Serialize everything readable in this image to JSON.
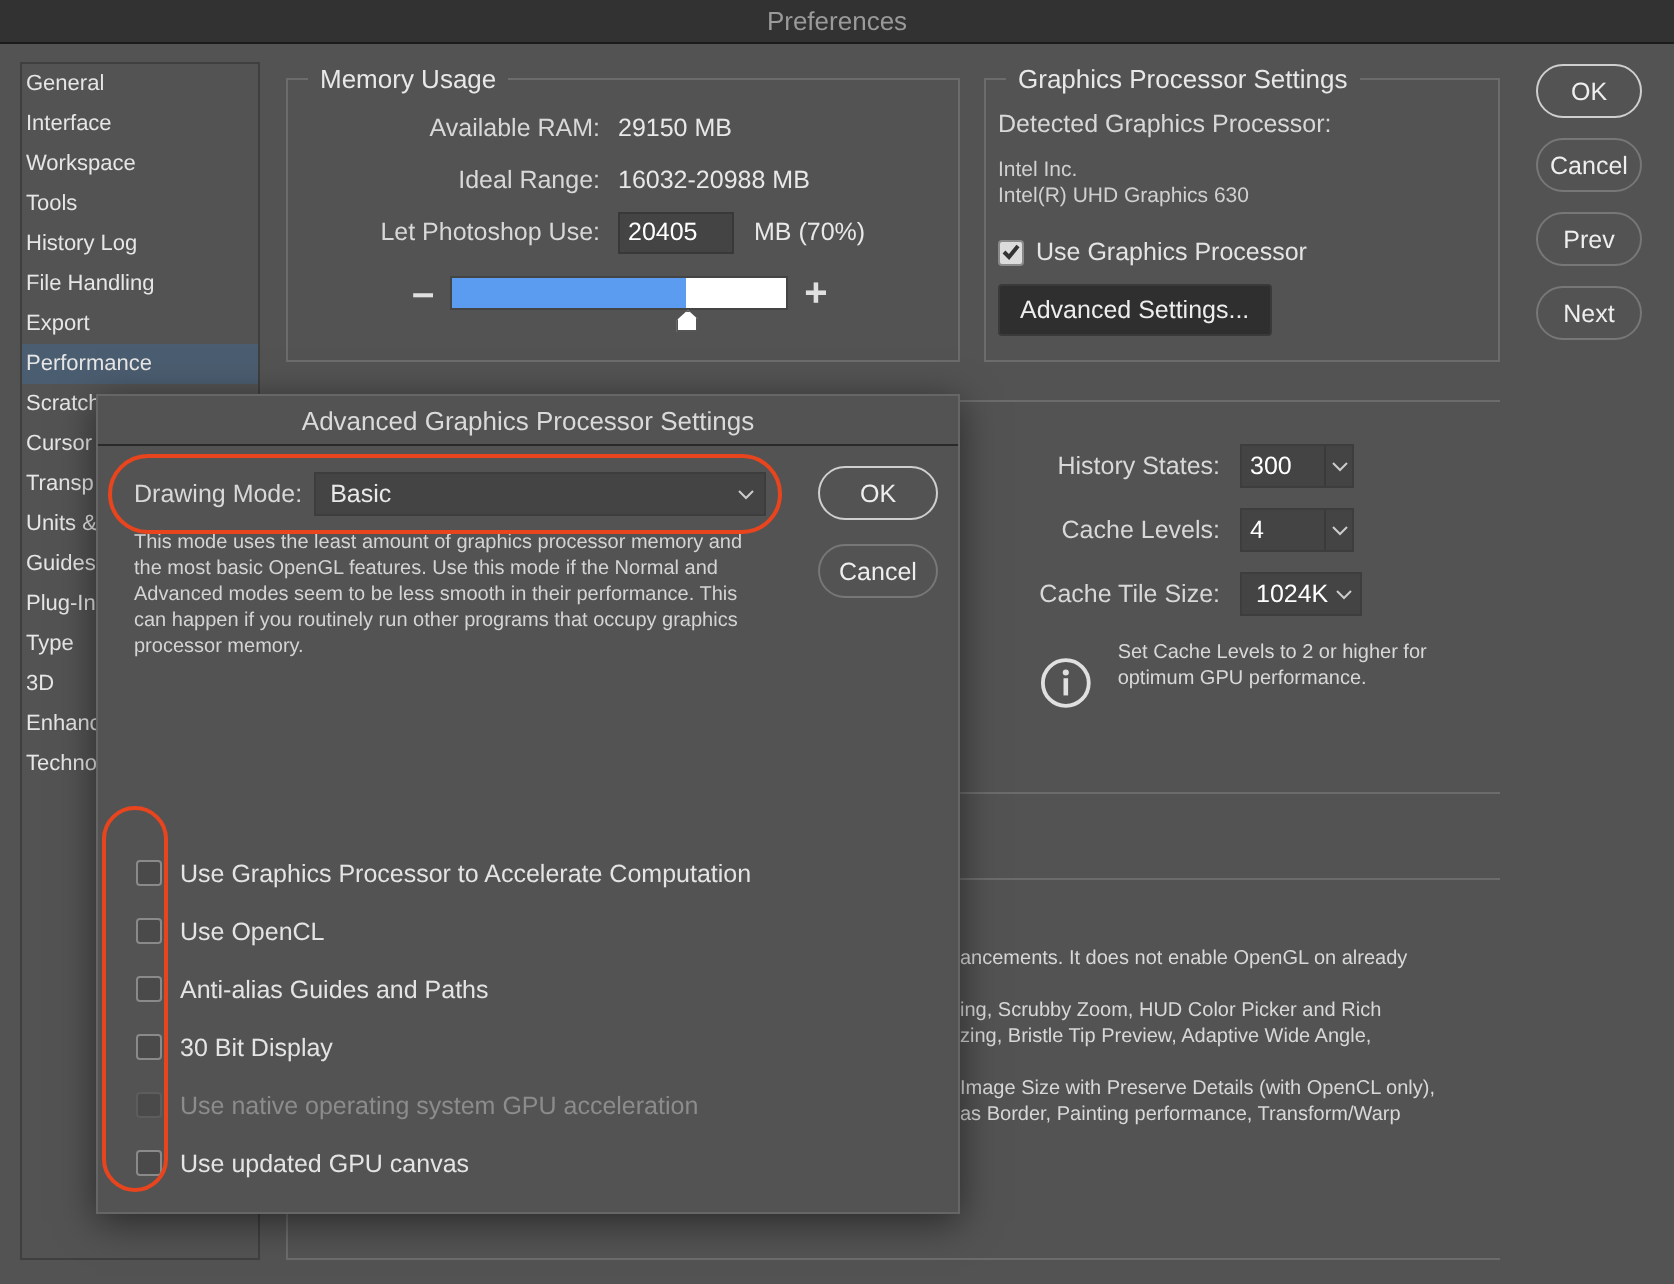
{
  "window": {
    "title": "Preferences"
  },
  "sidebar": {
    "items": [
      {
        "label": "General",
        "selected": false
      },
      {
        "label": "Interface",
        "selected": false
      },
      {
        "label": "Workspace",
        "selected": false
      },
      {
        "label": "Tools",
        "selected": false
      },
      {
        "label": "History Log",
        "selected": false
      },
      {
        "label": "File Handling",
        "selected": false
      },
      {
        "label": "Export",
        "selected": false
      },
      {
        "label": "Performance",
        "selected": true
      },
      {
        "label": "Scratch",
        "selected": false
      },
      {
        "label": "Cursor",
        "selected": false
      },
      {
        "label": "Transp",
        "selected": false
      },
      {
        "label": "Units &",
        "selected": false
      },
      {
        "label": "Guides",
        "selected": false
      },
      {
        "label": "Plug-In",
        "selected": false
      },
      {
        "label": "Type",
        "selected": false
      },
      {
        "label": "3D",
        "selected": false
      },
      {
        "label": "Enhanc",
        "selected": false
      },
      {
        "label": "Techno",
        "selected": false
      }
    ]
  },
  "memory_usage": {
    "title": "Memory Usage",
    "rows": [
      {
        "label": "Available RAM:",
        "value": "29150 MB"
      },
      {
        "label": "Ideal Range:",
        "value": "16032-20988 MB"
      }
    ],
    "use": {
      "label": "Let Photoshop Use:",
      "value": "20405",
      "unit": "MB (70%)"
    },
    "slider": {
      "minus": "–",
      "plus": "+",
      "level": 0.7
    }
  },
  "graphics_processor": {
    "title": "Graphics Processor Settings",
    "detected_label": "Detected Graphics Processor:",
    "vendor": "Intel Inc.",
    "model": "Intel(R) UHD Graphics 630",
    "use_gpu": {
      "label": "Use Graphics Processor",
      "checked": true
    },
    "advanced_button": "Advanced Settings..."
  },
  "buttons": [
    {
      "label": "OK",
      "default": true
    },
    {
      "label": "Cancel",
      "default": false
    },
    {
      "label": "Prev",
      "default": false
    },
    {
      "label": "Next",
      "default": false
    }
  ],
  "cache": {
    "fields": [
      {
        "label": "History States:",
        "value": "300",
        "kind": "combo"
      },
      {
        "label": "Cache Levels:",
        "value": "4",
        "kind": "combo"
      },
      {
        "label": "Cache Tile Size:",
        "value": "1024K",
        "kind": "select"
      }
    ],
    "info": "Set Cache Levels to 2 or higher for optimum GPU performance."
  },
  "notes": [
    {
      "lines": [
        "ancements. It does not enable OpenGL on already"
      ]
    },
    {
      "lines": [
        "ing, Scrubby Zoom, HUD Color Picker and Rich",
        "zing, Bristle Tip Preview, Adaptive Wide Angle,"
      ]
    },
    {
      "lines": [
        "Image Size with Preserve Details (with OpenCL only),",
        "as Border, Painting performance, Transform/Warp"
      ]
    }
  ],
  "dialog": {
    "title": "Advanced Graphics Processor Settings",
    "drawing_mode": {
      "label": "Drawing Mode:",
      "value": "Basic",
      "highlighted": true
    },
    "description": "This mode uses the least amount of graphics processor memory and the most basic OpenGL features.  Use this mode if the Normal and Advanced modes seem to be less smooth in their performance.  This can happen if you routinely run other programs that occupy graphics processor memory.",
    "buttons": [
      {
        "label": "OK",
        "default": true
      },
      {
        "label": "Cancel",
        "default": false
      }
    ],
    "options_highlighted": true,
    "options": [
      {
        "label": "Use Graphics Processor to Accelerate Computation",
        "checked": false,
        "disabled": false
      },
      {
        "label": "Use OpenCL",
        "checked": false,
        "disabled": false
      },
      {
        "label": "Anti-alias Guides and Paths",
        "checked": false,
        "disabled": false
      },
      {
        "label": "30 Bit Display",
        "checked": false,
        "disabled": false
      },
      {
        "label": "Use native operating system GPU acceleration",
        "checked": false,
        "disabled": true
      },
      {
        "label": "Use updated GPU canvas",
        "checked": false,
        "disabled": false
      }
    ]
  }
}
